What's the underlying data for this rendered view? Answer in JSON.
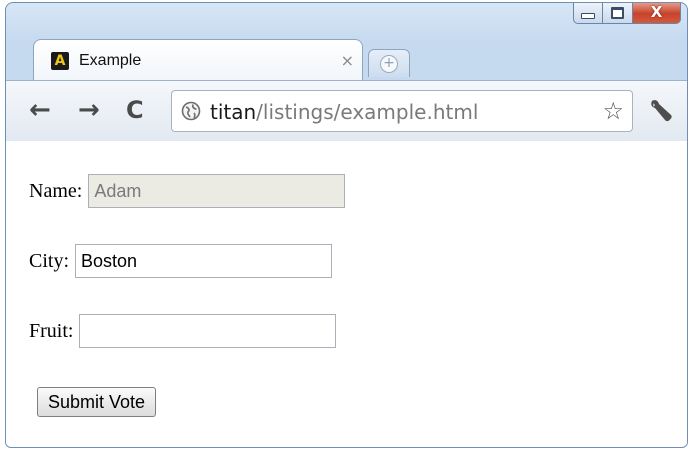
{
  "tab": {
    "title": "Example",
    "close_glyph": "×",
    "favicon_letter": "A"
  },
  "window_controls": {
    "close_glyph": "X"
  },
  "toolbar": {
    "back_glyph": "←",
    "forward_glyph": "→",
    "reload_glyph": "C",
    "url_host": "titan",
    "url_path": "/listings/example.html",
    "star_glyph": "☆"
  },
  "form": {
    "name_label": "Name:",
    "name_value": "Adam",
    "city_label": "City:",
    "city_value": "Boston",
    "fruit_label": "Fruit:",
    "fruit_value": "",
    "submit_label": "Submit Vote"
  },
  "icons": [
    "globe-icon",
    "star-icon",
    "wrench-icon",
    "new-tab-icon",
    "minimize-icon",
    "maximize-icon",
    "close-icon"
  ]
}
